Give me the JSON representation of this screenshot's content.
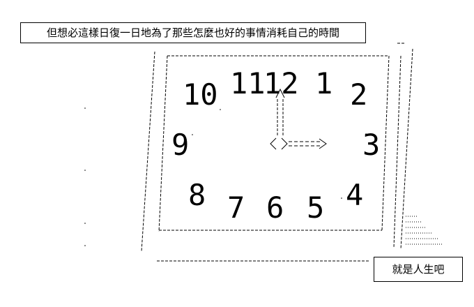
{
  "captions": {
    "top": "但想必這樣日復一日地為了那些怎麼也好的事情消耗自己的時間",
    "bottom": "就是人生吧"
  },
  "clock": {
    "numerals": [
      "10",
      "11",
      "12",
      "1",
      "2",
      "9",
      "3",
      "8",
      "7",
      "6",
      "5",
      "4"
    ],
    "hour_hand": "Λ",
    "minute_hand": "〈〉===>",
    "time_shown": "3:00"
  },
  "colors": {
    "ink": "#000000",
    "background": "#ffffff"
  },
  "icons": [
    "clock-face",
    "hour-hand",
    "minute-hand"
  ]
}
